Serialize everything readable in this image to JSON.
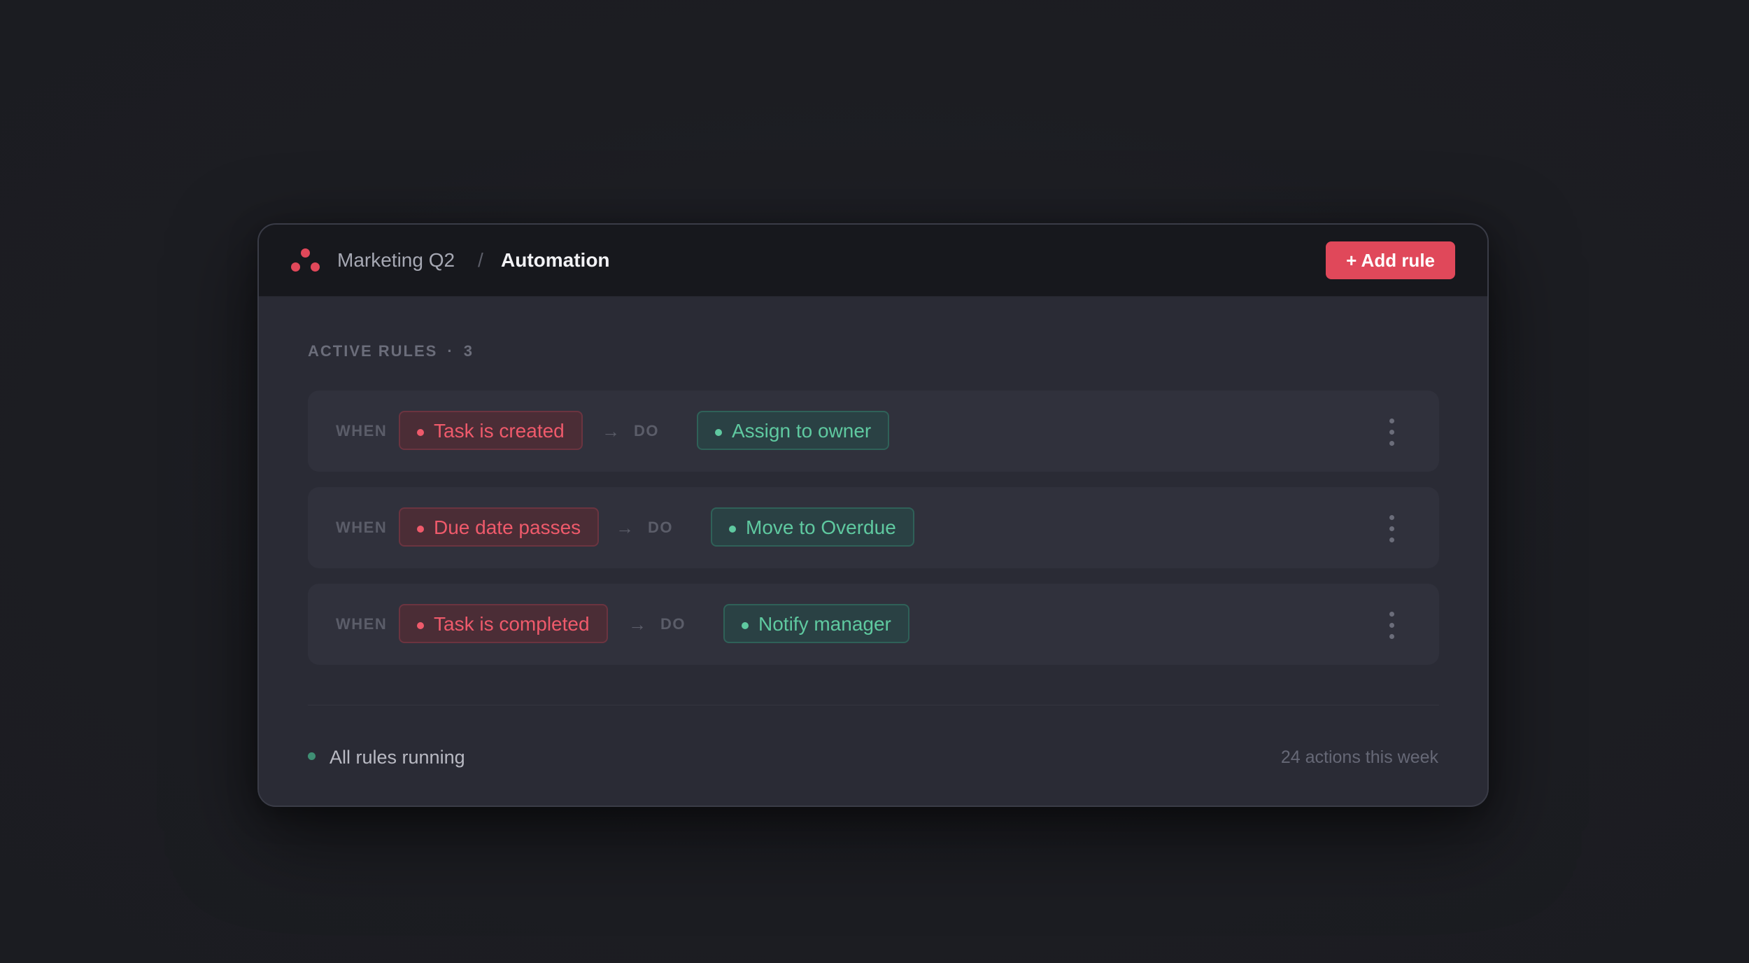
{
  "header": {
    "breadcrumb_project": "Marketing Q2",
    "breadcrumb_separator": "/",
    "breadcrumb_current": "Automation",
    "add_button_label": "+ Add rule"
  },
  "section": {
    "label": "ACTIVE RULES",
    "separator": "·",
    "count": "3"
  },
  "rules": [
    {
      "when": "WHEN",
      "trigger": "Task is created",
      "arrow": "→",
      "do": "DO",
      "action": "Assign to owner"
    },
    {
      "when": "WHEN",
      "trigger": "Due date passes",
      "arrow": "→",
      "do": "DO",
      "action": "Move to Overdue"
    },
    {
      "when": "WHEN",
      "trigger": "Task is completed",
      "arrow": "→",
      "do": "DO",
      "action": "Notify manager"
    }
  ],
  "footer": {
    "status": "All rules running",
    "activity": "24 actions this week"
  },
  "colors": {
    "accent": "#e0485a",
    "trigger_text": "#ef5a6b",
    "action_text": "#5fc9a0",
    "status_ok": "#3f8f74"
  },
  "icons": {
    "logo": "three-dots-logo-icon",
    "arrow": "arrow-right-icon",
    "menu": "more-vertical-icon",
    "status": "status-dot-icon"
  }
}
